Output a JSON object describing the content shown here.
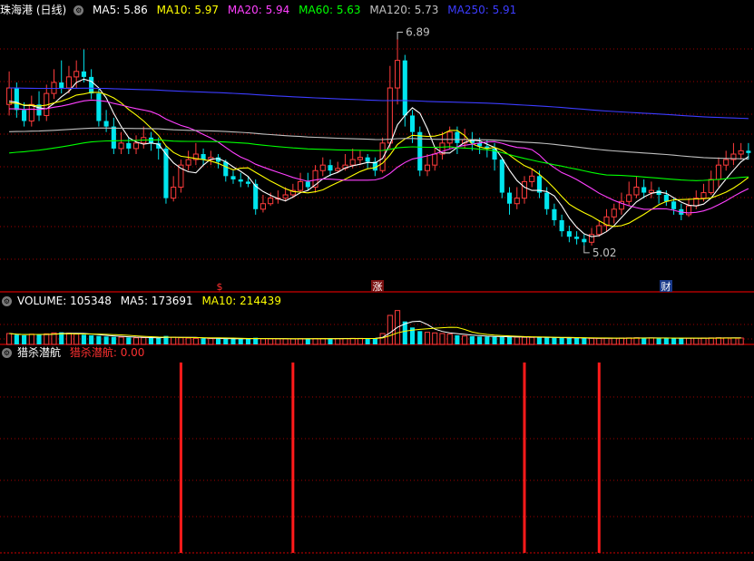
{
  "header": {
    "stock_title": "珠海港 (日线)",
    "indicators": [
      {
        "label": "MA5: 5.86",
        "color": "#ffffff"
      },
      {
        "label": "MA10: 5.97",
        "color": "#ffff00"
      },
      {
        "label": "MA20: 5.94",
        "color": "#ff40ff"
      },
      {
        "label": "MA60: 5.63",
        "color": "#00ff00"
      },
      {
        "label": "MA120: 5.73",
        "color": "#c0c0c0"
      },
      {
        "label": "MA250: 5.91",
        "color": "#3c3cff"
      }
    ]
  },
  "volume_header": {
    "title": "VOLUME: 105348",
    "ma5": "MA5: 173691",
    "ma10": "MA10: 214439"
  },
  "indicator_header": {
    "title": "猎杀潜航",
    "value_label": "猎杀潜航: 0.00"
  },
  "annotations": {
    "high_label": "6.89",
    "low_label": "5.02",
    "markers": [
      {
        "text": "$",
        "color": "#ff3030"
      },
      {
        "text": "涨",
        "color": "#ffffff"
      },
      {
        "text": "财",
        "color": "#ffffff"
      }
    ]
  },
  "colors": {
    "up": "#ff3c3c",
    "down": "#00e5ee",
    "grid": "#a00000",
    "signal": "#ff1a1a",
    "ma5": "#ffffff",
    "ma10": "#ffff00",
    "ma20": "#ff40ff",
    "ma60": "#00ff00",
    "ma120": "#c0c0c0",
    "ma250": "#3c3cff"
  },
  "chart_data": [
    {
      "type": "candlestick",
      "description_of_axes": "daily candles, price axis not printed",
      "ylim": [
        4.6,
        7.1
      ],
      "candles": [
        [
          6.3,
          6.45,
          6.6,
          6.2
        ],
        [
          6.45,
          6.25,
          6.5,
          6.18
        ],
        [
          6.25,
          6.15,
          6.32,
          6.1
        ],
        [
          6.15,
          6.3,
          6.38,
          6.1
        ],
        [
          6.3,
          6.2,
          6.42,
          6.15
        ],
        [
          6.2,
          6.4,
          6.48,
          6.15
        ],
        [
          6.4,
          6.5,
          6.62,
          6.35
        ],
        [
          6.5,
          6.45,
          6.7,
          6.4
        ],
        [
          6.45,
          6.55,
          6.65,
          6.4
        ],
        [
          6.55,
          6.6,
          6.7,
          6.45
        ],
        [
          6.6,
          6.55,
          6.8,
          6.5
        ],
        [
          6.55,
          6.4,
          6.62,
          6.35
        ],
        [
          6.4,
          6.15,
          6.45,
          6.1
        ],
        [
          6.15,
          6.1,
          6.25,
          6.05
        ],
        [
          6.1,
          5.9,
          6.18,
          5.85
        ],
        [
          5.9,
          5.95,
          6.05,
          5.85
        ],
        [
          5.95,
          5.9,
          6.0,
          5.85
        ],
        [
          5.9,
          5.95,
          6.02,
          5.85
        ],
        [
          5.95,
          6.0,
          6.1,
          5.9
        ],
        [
          6.0,
          5.95,
          6.05,
          5.88
        ],
        [
          5.95,
          5.9,
          6.0,
          5.8
        ],
        [
          5.9,
          5.45,
          5.92,
          5.4
        ],
        [
          5.45,
          5.55,
          5.65,
          5.42
        ],
        [
          5.55,
          5.75,
          5.8,
          5.5
        ],
        [
          5.75,
          5.8,
          5.88,
          5.7
        ],
        [
          5.8,
          5.85,
          5.95,
          5.75
        ],
        [
          5.85,
          5.8,
          5.9,
          5.75
        ],
        [
          5.8,
          5.82,
          5.88,
          5.75
        ],
        [
          5.82,
          5.78,
          5.85,
          5.72
        ],
        [
          5.78,
          5.65,
          5.8,
          5.6
        ],
        [
          5.65,
          5.62,
          5.7,
          5.58
        ],
        [
          5.62,
          5.6,
          5.68,
          5.55
        ],
        [
          5.6,
          5.58,
          5.65,
          5.55
        ],
        [
          5.58,
          5.35,
          5.62,
          5.3
        ],
        [
          5.35,
          5.4,
          5.48,
          5.32
        ],
        [
          5.4,
          5.45,
          5.5,
          5.38
        ],
        [
          5.45,
          5.45,
          5.52,
          5.4
        ],
        [
          5.45,
          5.48,
          5.55,
          5.42
        ],
        [
          5.48,
          5.52,
          5.58,
          5.45
        ],
        [
          5.52,
          5.6,
          5.68,
          5.5
        ],
        [
          5.6,
          5.55,
          5.68,
          5.52
        ],
        [
          5.55,
          5.7,
          5.75,
          5.5
        ],
        [
          5.7,
          5.75,
          5.82,
          5.65
        ],
        [
          5.75,
          5.7,
          5.8,
          5.65
        ],
        [
          5.7,
          5.72,
          5.78,
          5.68
        ],
        [
          5.72,
          5.75,
          5.85,
          5.7
        ],
        [
          5.75,
          5.8,
          5.9,
          5.72
        ],
        [
          5.8,
          5.82,
          5.88,
          5.75
        ],
        [
          5.82,
          5.78,
          5.85,
          5.72
        ],
        [
          5.78,
          5.7,
          5.82,
          5.65
        ],
        [
          5.7,
          5.95,
          6.0,
          5.68
        ],
        [
          5.95,
          6.45,
          6.65,
          5.9
        ],
        [
          6.45,
          6.7,
          6.89,
          6.3
        ],
        [
          6.7,
          6.2,
          6.75,
          6.1
        ],
        [
          6.2,
          6.05,
          6.25,
          5.95
        ],
        [
          6.05,
          5.7,
          6.1,
          5.65
        ],
        [
          5.7,
          5.75,
          5.85,
          5.65
        ],
        [
          5.75,
          5.85,
          5.92,
          5.7
        ],
        [
          5.85,
          5.95,
          6.05,
          5.8
        ],
        [
          5.95,
          6.05,
          6.1,
          5.9
        ],
        [
          6.05,
          5.95,
          6.1,
          5.85
        ],
        [
          5.95,
          5.98,
          6.08,
          5.9
        ],
        [
          5.98,
          5.95,
          6.05,
          5.88
        ],
        [
          5.95,
          5.92,
          6.0,
          5.85
        ],
        [
          5.92,
          5.9,
          5.98,
          5.82
        ],
        [
          5.9,
          5.8,
          5.95,
          5.7
        ],
        [
          5.8,
          5.5,
          5.82,
          5.45
        ],
        [
          5.5,
          5.4,
          5.55,
          5.3
        ],
        [
          5.4,
          5.45,
          5.55,
          5.35
        ],
        [
          5.45,
          5.6,
          5.65,
          5.4
        ],
        [
          5.6,
          5.65,
          5.72,
          5.55
        ],
        [
          5.65,
          5.5,
          5.7,
          5.45
        ],
        [
          5.5,
          5.35,
          5.55,
          5.3
        ],
        [
          5.35,
          5.25,
          5.4,
          5.2
        ],
        [
          5.25,
          5.15,
          5.3,
          5.1
        ],
        [
          5.15,
          5.1,
          5.2,
          5.05
        ],
        [
          5.1,
          5.08,
          5.15,
          5.03
        ],
        [
          5.08,
          5.05,
          5.12,
          5.02
        ],
        [
          5.05,
          5.12,
          5.18,
          5.02
        ],
        [
          5.12,
          5.2,
          5.25,
          5.1
        ],
        [
          5.2,
          5.28,
          5.35,
          5.15
        ],
        [
          5.28,
          5.35,
          5.4,
          5.22
        ],
        [
          5.35,
          5.42,
          5.5,
          5.3
        ],
        [
          5.42,
          5.48,
          5.6,
          5.38
        ],
        [
          5.48,
          5.55,
          5.65,
          5.45
        ],
        [
          5.55,
          5.5,
          5.62,
          5.45
        ],
        [
          5.5,
          5.52,
          5.6,
          5.45
        ],
        [
          5.52,
          5.48,
          5.55,
          5.4
        ],
        [
          5.48,
          5.42,
          5.52,
          5.38
        ],
        [
          5.42,
          5.35,
          5.45,
          5.3
        ],
        [
          5.35,
          5.3,
          5.4,
          5.25
        ],
        [
          5.3,
          5.38,
          5.45,
          5.28
        ],
        [
          5.38,
          5.45,
          5.52,
          5.35
        ],
        [
          5.45,
          5.5,
          5.58,
          5.42
        ],
        [
          5.5,
          5.62,
          5.7,
          5.48
        ],
        [
          5.62,
          5.75,
          5.82,
          5.55
        ],
        [
          5.75,
          5.8,
          5.88,
          5.7
        ],
        [
          5.8,
          5.85,
          5.95,
          5.75
        ],
        [
          5.85,
          5.88,
          5.95,
          5.8
        ],
        [
          5.88,
          5.86,
          5.95,
          5.8
        ]
      ]
    },
    {
      "type": "bar",
      "title": "VOLUME: 105348",
      "ylim": [
        0,
        600000
      ],
      "values": [
        180000,
        160000,
        150000,
        170000,
        165000,
        175000,
        190000,
        200000,
        185000,
        170000,
        160000,
        150000,
        140000,
        130000,
        125000,
        120000,
        115000,
        110000,
        112000,
        108000,
        105000,
        140000,
        120000,
        110000,
        105000,
        100000,
        98000,
        96000,
        95000,
        94000,
        93000,
        92000,
        90000,
        110000,
        95000,
        92000,
        90000,
        91000,
        93000,
        95000,
        94000,
        96000,
        98000,
        97000,
        96000,
        98000,
        100000,
        99000,
        98000,
        97000,
        180000,
        480000,
        560000,
        380000,
        280000,
        220000,
        200000,
        190000,
        180000,
        170000,
        150000,
        140000,
        135000,
        130000,
        128000,
        126000,
        124000,
        122000,
        120000,
        118000,
        116000,
        114000,
        112000,
        110000,
        108000,
        106000,
        104000,
        102000,
        100000,
        100000,
        102000,
        104000,
        106000,
        108000,
        110000,
        108000,
        106000,
        104000,
        102000,
        100000,
        100000,
        102000,
        104000,
        106000,
        108000,
        110000,
        108000,
        106000,
        105348
      ]
    },
    {
      "type": "bar",
      "title": "猎杀潜航",
      "ylim": [
        0,
        1
      ],
      "signal_index": [
        23,
        38,
        69,
        79
      ],
      "values_note": "signal pulses"
    }
  ]
}
